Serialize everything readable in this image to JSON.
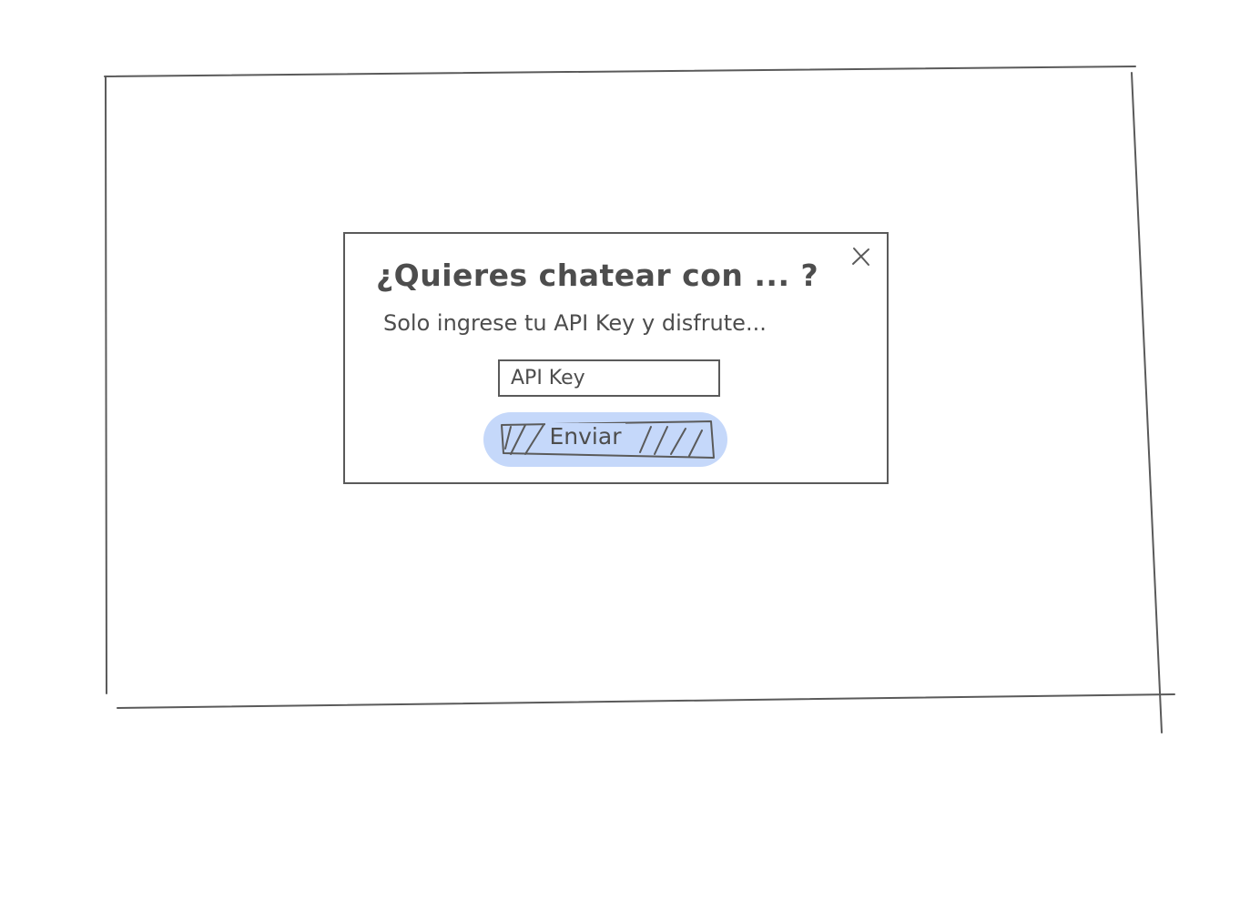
{
  "modal": {
    "title": "¿Quieres chatear con ... ?",
    "subtitle": "Solo ingrese tu API Key y disfrute...",
    "input": {
      "placeholder": "API Key",
      "value": ""
    },
    "submit_label": "Enviar",
    "close_icon": "close-icon"
  },
  "colors": {
    "stroke": "#5a5a5a",
    "button_fill": "#c5d8fa",
    "text": "#4d4d4d"
  }
}
